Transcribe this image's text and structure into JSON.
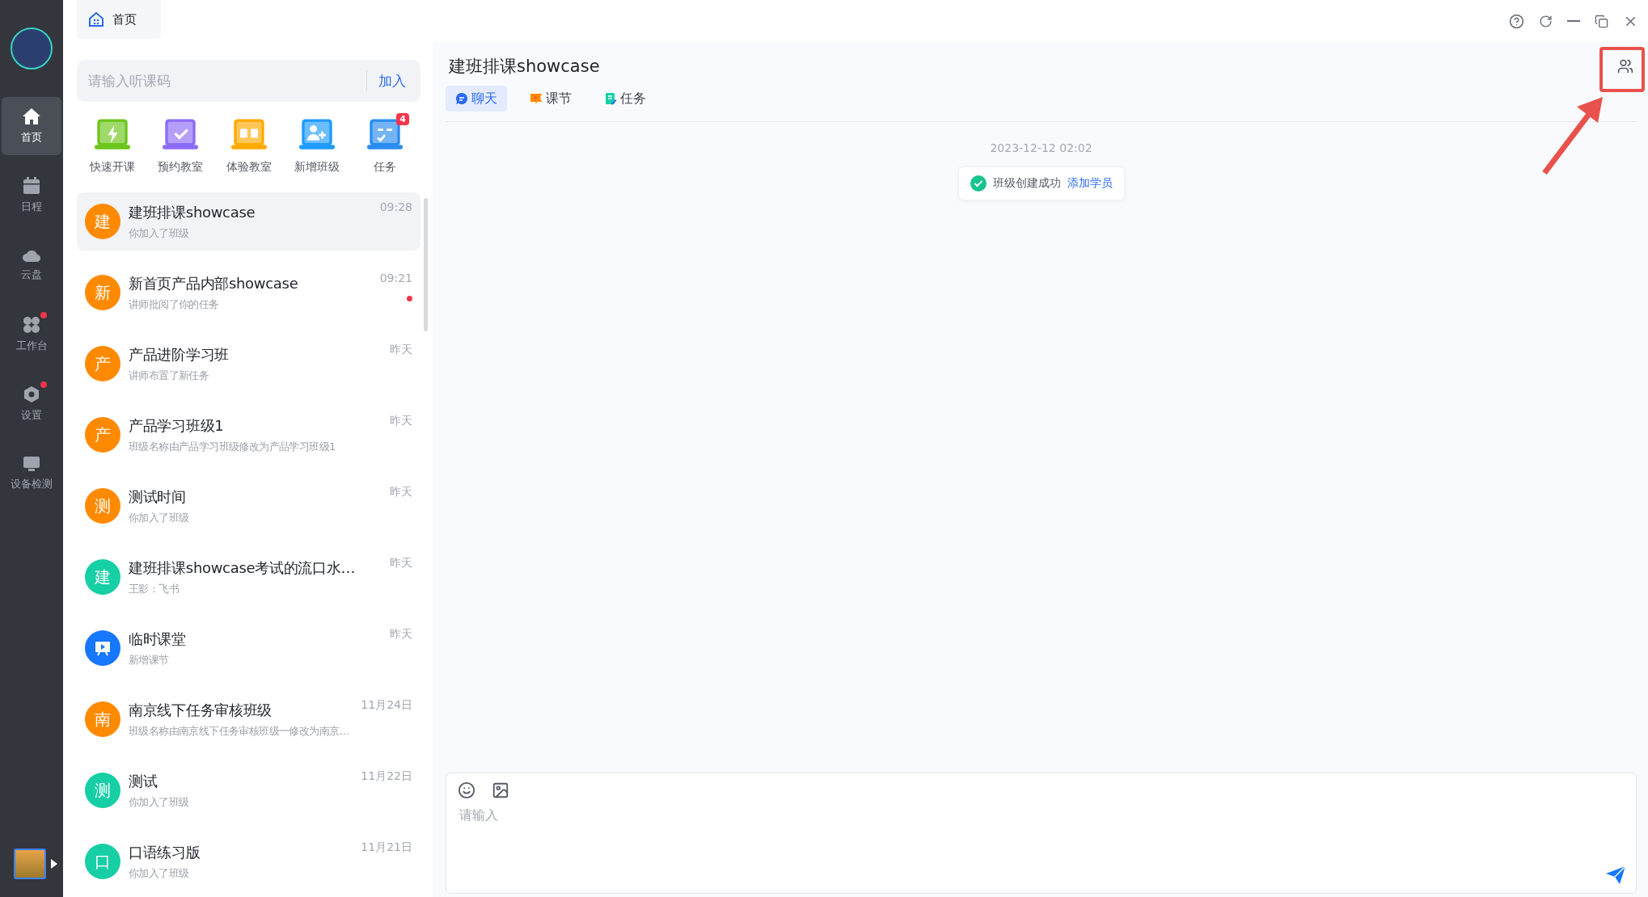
{
  "home_tab": {
    "label": "首页"
  },
  "nav": {
    "items": [
      {
        "kind": "home",
        "label": "首页",
        "selected": true,
        "dot": false
      },
      {
        "kind": "calendar",
        "label": "日程",
        "selected": false,
        "dot": false
      },
      {
        "kind": "cloud",
        "label": "云盘",
        "selected": false,
        "dot": false
      },
      {
        "kind": "apps",
        "label": "工作台",
        "selected": false,
        "dot": true
      },
      {
        "kind": "settings",
        "label": "设置",
        "selected": false,
        "dot": true
      },
      {
        "kind": "device",
        "label": "设备检测",
        "selected": false,
        "dot": false
      }
    ]
  },
  "join": {
    "placeholder": "请输入听课码",
    "button": "加入"
  },
  "quick_actions": [
    {
      "kind": "bolt",
      "label": "快速开课",
      "color": "#6cc51b"
    },
    {
      "kind": "check",
      "label": "预约教室",
      "color": "#8b6cf7"
    },
    {
      "kind": "ab",
      "label": "体验教室",
      "color": "#ffaa00"
    },
    {
      "kind": "people",
      "label": "新增班级",
      "color": "#1e9bff"
    },
    {
      "kind": "list",
      "label": "任务",
      "color": "#2a8cf0",
      "badge": "4"
    }
  ],
  "conversations": [
    {
      "kind": "letter",
      "avatar_text": "建",
      "color": "#ff8a00",
      "title": "建班排课showcase",
      "preview": "你加入了班级",
      "time": "09:28",
      "selected": true,
      "unread": false
    },
    {
      "kind": "letter",
      "avatar_text": "新",
      "color": "#ff8a00",
      "title": "新首页产品内部showcase",
      "preview": "讲师批阅了你的任务",
      "time": "09:21",
      "selected": false,
      "unread": true
    },
    {
      "kind": "letter",
      "avatar_text": "产",
      "color": "#ff8a00",
      "title": "产品进阶学习班",
      "preview": "讲师布置了新任务",
      "time": "昨天",
      "selected": false,
      "unread": false
    },
    {
      "kind": "letter",
      "avatar_text": "产",
      "color": "#ff8a00",
      "title": "产品学习班级1",
      "preview": "班级名称由产品学习班级修改为产品学习班级1",
      "time": "昨天",
      "selected": false,
      "unread": false
    },
    {
      "kind": "letter",
      "avatar_text": "测",
      "color": "#ff8a00",
      "title": "测试时间",
      "preview": "你加入了班级",
      "time": "昨天",
      "selected": false,
      "unread": false
    },
    {
      "kind": "letter",
      "avatar_text": "建",
      "color": "#17cfa5",
      "title": "建班排课showcase考试的流口水…",
      "preview": "王影：飞书",
      "time": "昨天",
      "selected": false,
      "unread": false
    },
    {
      "kind": "icon",
      "color": "#1677ff",
      "title": "临时课堂",
      "preview": "新增课节",
      "time": "昨天",
      "selected": false,
      "unread": false
    },
    {
      "kind": "letter",
      "avatar_text": "南",
      "color": "#ff8a00",
      "title": "南京线下任务审核班级",
      "preview": "班级名称由南京线下任务审核班级一修改为南京…",
      "time": "11月24日",
      "selected": false,
      "unread": false
    },
    {
      "kind": "letter",
      "avatar_text": "测",
      "color": "#17cfa5",
      "title": "测试",
      "preview": "你加入了班级",
      "time": "11月22日",
      "selected": false,
      "unread": false
    },
    {
      "kind": "letter",
      "avatar_text": "口",
      "color": "#17cfa5",
      "title": "口语练习版",
      "preview": "你加入了班级",
      "time": "11月21日",
      "selected": false,
      "unread": false
    }
  ],
  "chat": {
    "title": "建班排课showcase",
    "tabs": [
      {
        "kind": "chat",
        "label": "聊天",
        "selected": true
      },
      {
        "kind": "lesson",
        "label": "课节",
        "selected": false
      },
      {
        "kind": "task",
        "label": "任务",
        "selected": false
      }
    ],
    "timestamp": "2023-12-12 02:02",
    "notice": {
      "text": "班级创建成功",
      "link": "添加学员"
    },
    "input": {
      "placeholder": "请输入"
    }
  }
}
